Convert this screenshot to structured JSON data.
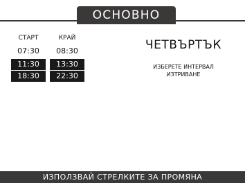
{
  "header": {
    "title": "ОСНОВНО"
  },
  "columns": {
    "start": "СТАРТ",
    "end": "КРАЙ"
  },
  "intervals": [
    {
      "start": "07:30",
      "end": "08:30",
      "selected": false
    },
    {
      "start": "11:30",
      "end": "13:30",
      "selected": true
    },
    {
      "start": "18:30",
      "end": "22:30",
      "selected": true
    }
  ],
  "day": "ЧЕТВЪРТЪК",
  "hint": {
    "line1": "ИЗБЕРЕТЕ ИНТЕРВАЛ",
    "line2": "ИЗТРИВАНЕ"
  },
  "footer": {
    "text": "ИЗПОЛЗВАЙ СТРЕЛКИТЕ ЗА ПРОМЯНА"
  },
  "colors": {
    "bar": "#3b3838",
    "selected_bg": "#1a1a1a"
  }
}
